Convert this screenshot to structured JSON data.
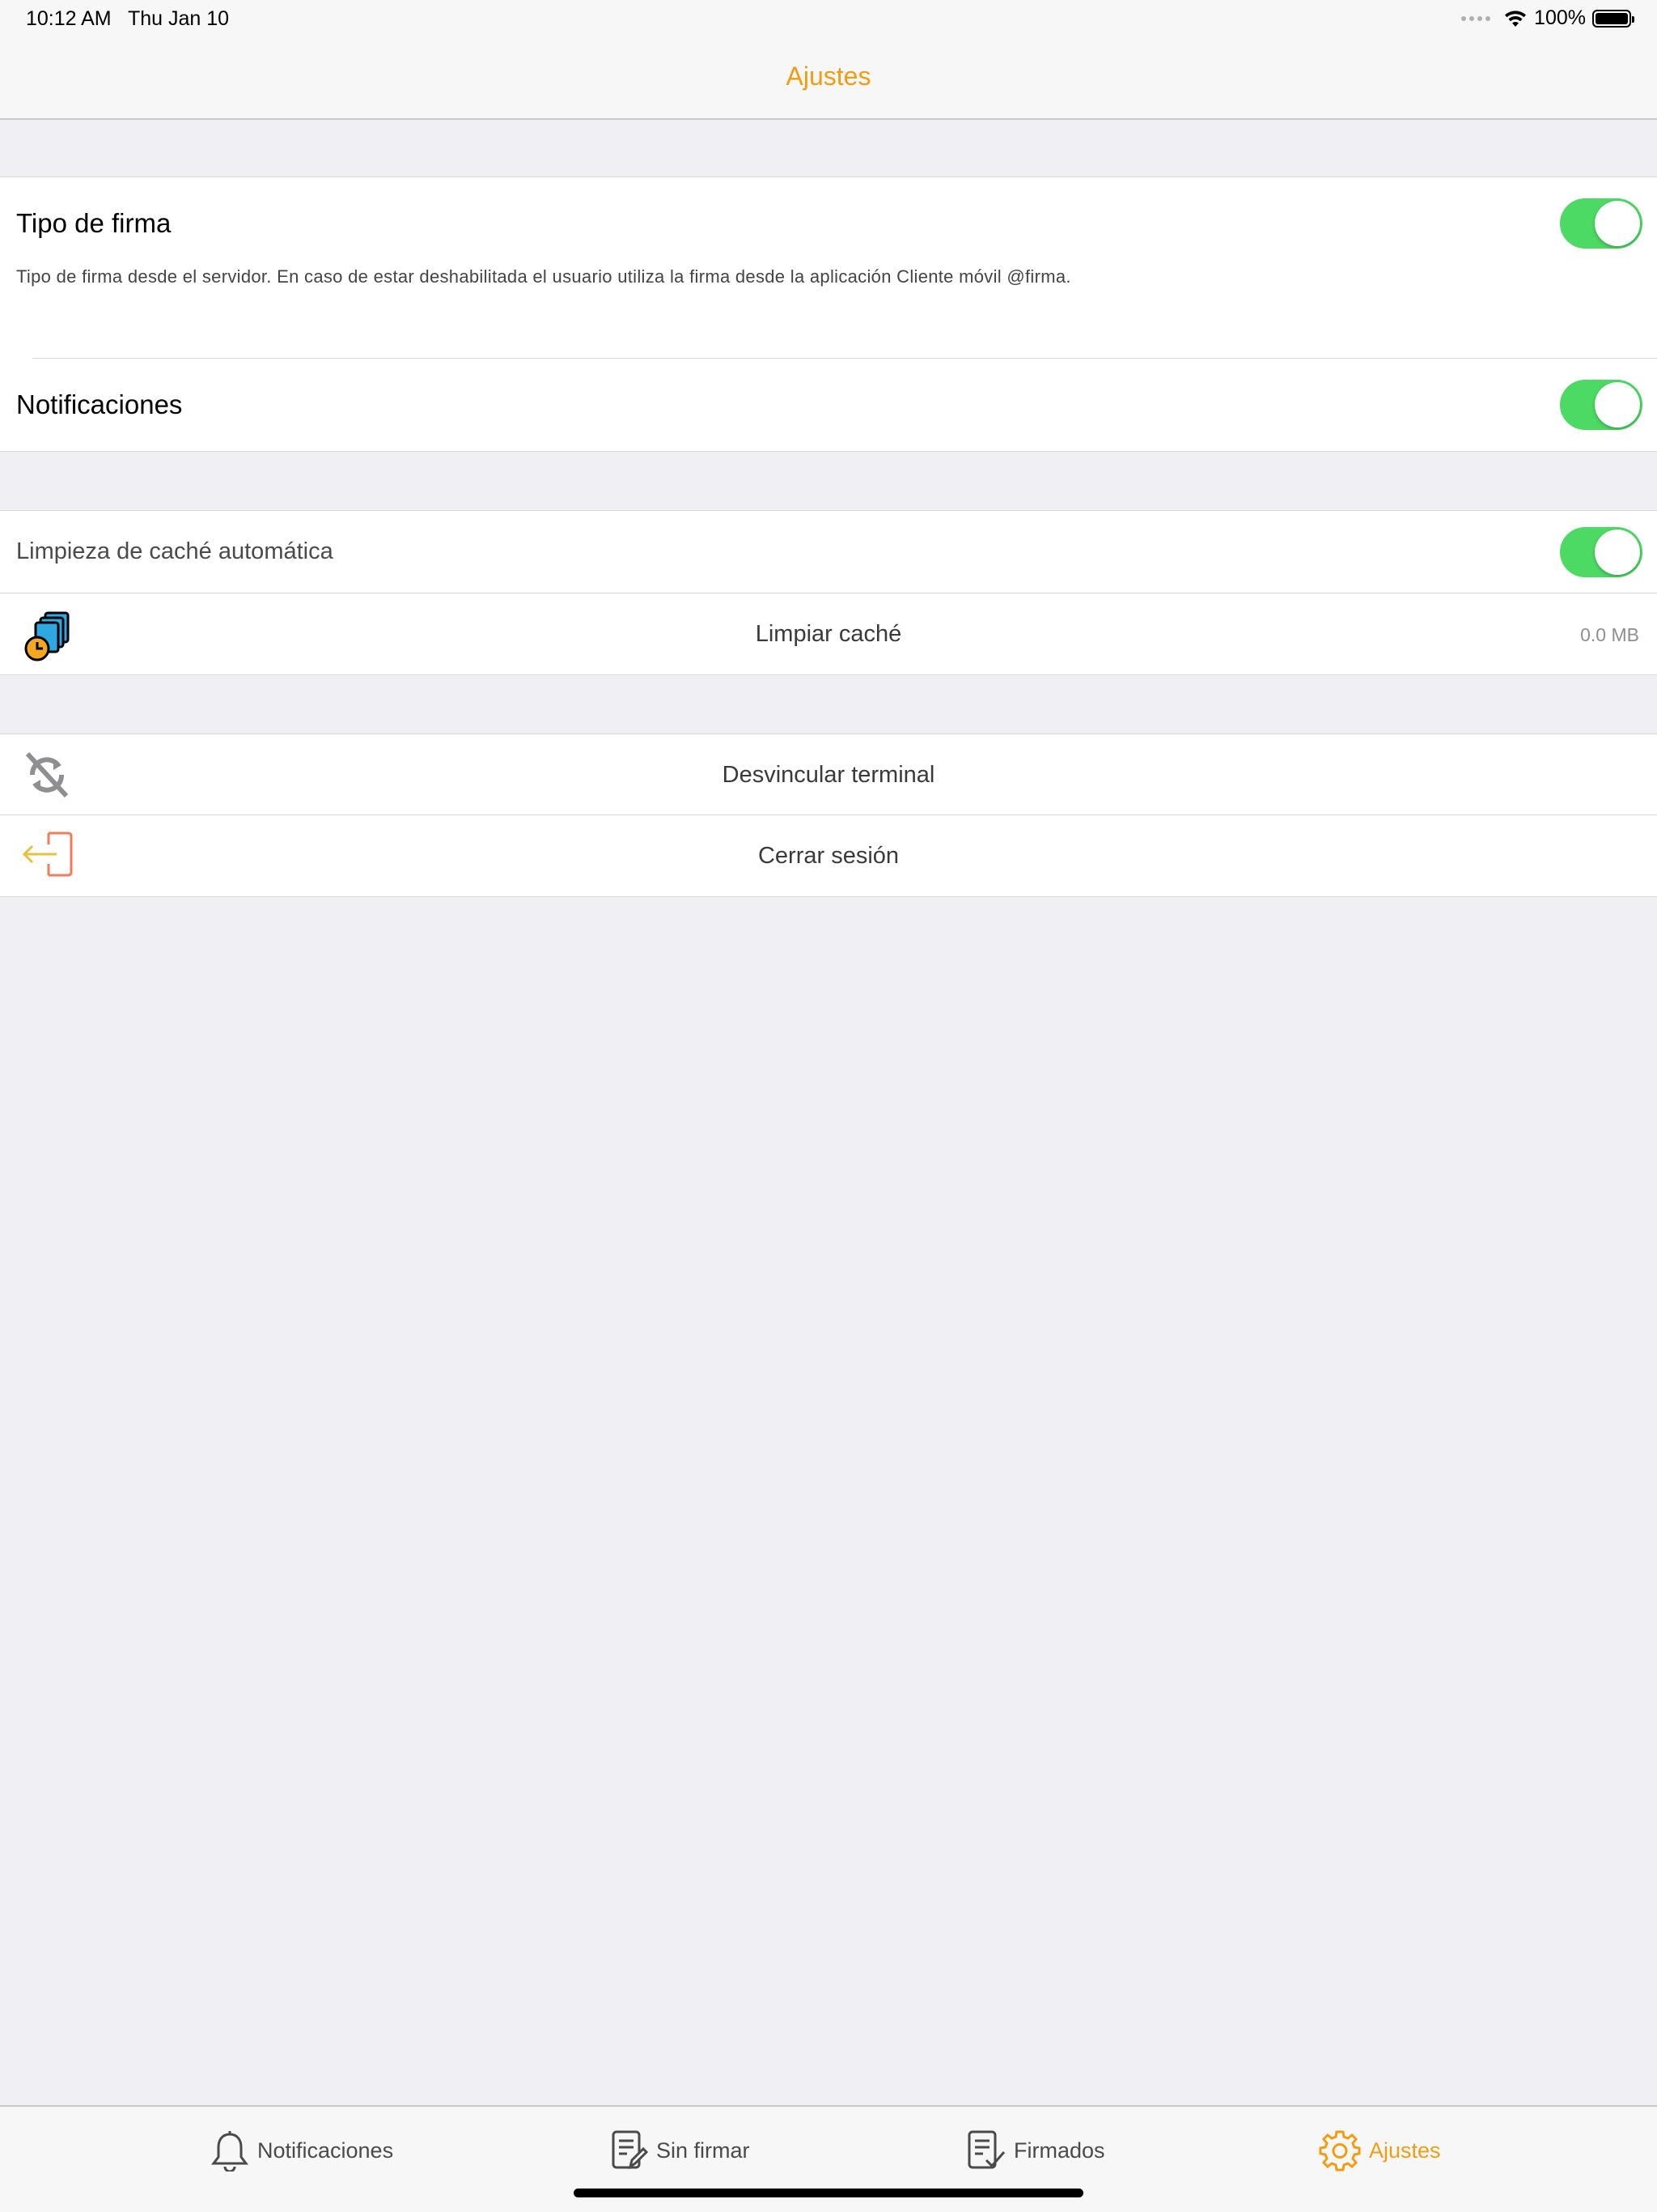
{
  "status_bar": {
    "time": "10:12 AM",
    "date": "Thu Jan 10",
    "battery": "100%"
  },
  "nav": {
    "title": "Ajustes"
  },
  "settings": {
    "tipo_firma": {
      "label": "Tipo de firma",
      "description": "Tipo de firma desde el servidor. En caso de estar deshabilitada el usuario utiliza la firma desde la aplicación Cliente móvil @firma.",
      "enabled": true
    },
    "notificaciones": {
      "label": "Notificaciones",
      "enabled": true
    },
    "limpieza_cache": {
      "label": "Limpieza de caché automática",
      "enabled": true
    },
    "limpiar_cache": {
      "label": "Limpiar caché",
      "value": "0.0 MB"
    },
    "desvincular": {
      "label": "Desvincular terminal"
    },
    "cerrar_sesion": {
      "label": "Cerrar sesión"
    }
  },
  "tabs": [
    {
      "label": "Notificaciones",
      "icon": "bell-icon"
    },
    {
      "label": "Sin firmar",
      "icon": "document-edit-icon"
    },
    {
      "label": "Firmados",
      "icon": "document-check-icon"
    },
    {
      "label": "Ajustes",
      "icon": "gear-icon",
      "active": true
    }
  ],
  "colors": {
    "accent": "#f39c12",
    "switch_on": "#4cd964",
    "background": "#efeff4"
  }
}
